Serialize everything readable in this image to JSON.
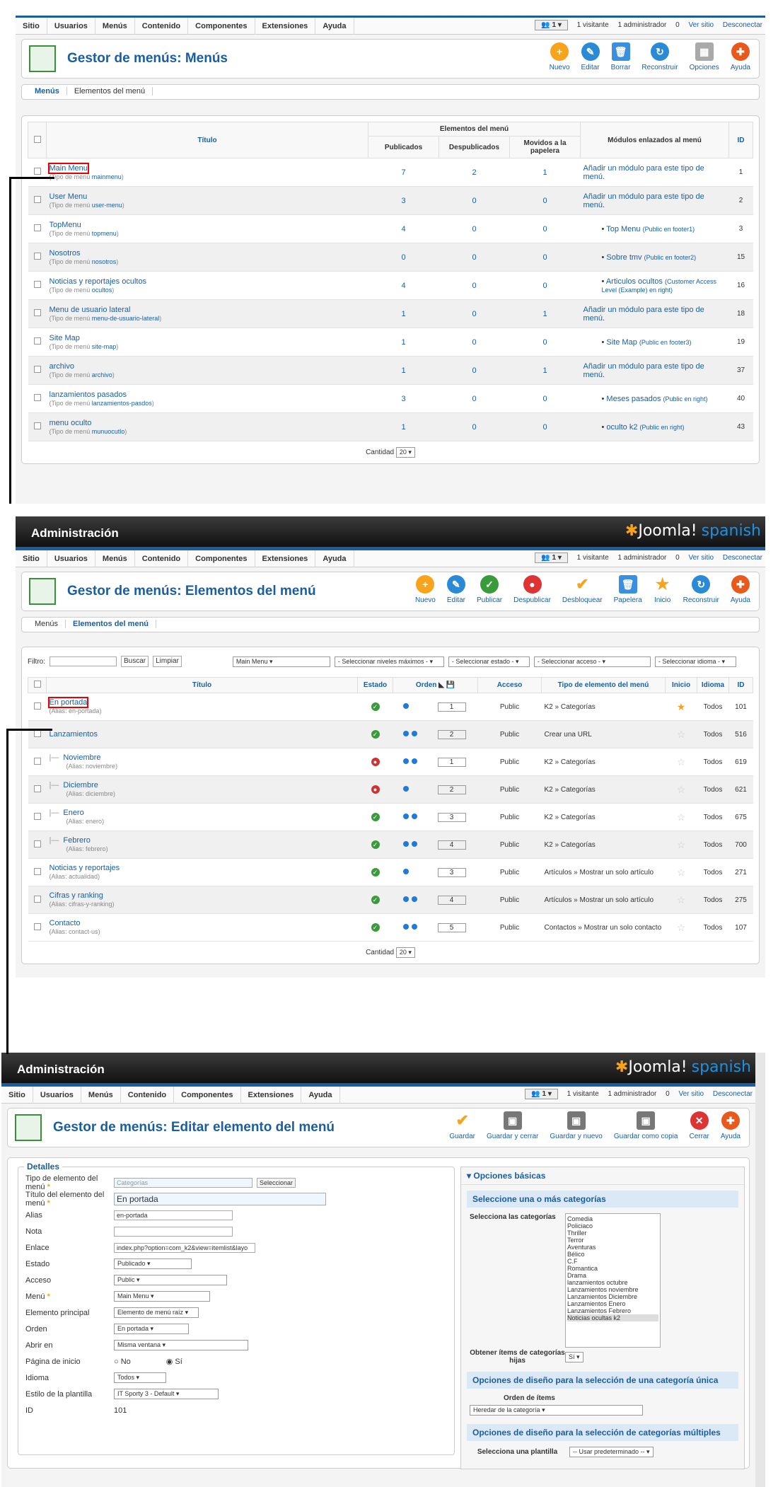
{
  "menubar": [
    "Sitio",
    "Usuarios",
    "Menús",
    "Contenido",
    "Componentes",
    "Extensiones",
    "Ayuda"
  ],
  "status": {
    "users": "1",
    "visitors": "1 visitante",
    "admins": "1 administrador",
    "msgs": "0",
    "view_site": "Ver sitio",
    "logout": "Desconectar"
  },
  "admin_title": "Administración",
  "logo_text": "Joomla!",
  "logo_sub": "spanish",
  "s1": {
    "title": "Gestor de menús: Menús",
    "toolbar": [
      "Nuevo",
      "Editar",
      "Borrar",
      "Reconstruir",
      "Opciones",
      "Ayuda"
    ],
    "tabs": [
      "Menús",
      "Elementos del menú"
    ],
    "group_header": "Elementos del menú",
    "cols": [
      "Título",
      "Publicados",
      "Despublicados",
      "Movidos a la papelera",
      "Módulos enlazados al menú",
      "ID"
    ],
    "type_prefix": "(Tipo de menú",
    "rows": [
      {
        "t": "Main Menu",
        "ty": "mainmenu",
        "p": "7",
        "d": "2",
        "x": "1",
        "mod": "Añadir un módulo para este tipo de menú.",
        "pos": "",
        "id": "1"
      },
      {
        "t": "User Menu",
        "ty": "user-menu",
        "p": "3",
        "d": "0",
        "x": "0",
        "mod": "Añadir un módulo para este tipo de menú.",
        "pos": "",
        "id": "2"
      },
      {
        "t": "TopMenu",
        "ty": "topmenu",
        "p": "4",
        "d": "0",
        "x": "0",
        "mod": "Top Menu",
        "pos": "(Public en footer1)",
        "id": "3"
      },
      {
        "t": "Nosotros",
        "ty": "nosotros",
        "p": "0",
        "d": "0",
        "x": "0",
        "mod": "Sobre tmv",
        "pos": "(Public en footer2)",
        "id": "15"
      },
      {
        "t": "Noticias y reportajes ocultos",
        "ty": "ocultos",
        "p": "4",
        "d": "0",
        "x": "0",
        "mod": "Articulos ocultos",
        "pos": "(Customer Access Level (Example) en right)",
        "id": "16"
      },
      {
        "t": "Menu de usuario lateral",
        "ty": "menu-de-usuario-lateral",
        "p": "1",
        "d": "0",
        "x": "1",
        "mod": "Añadir un módulo para este tipo de menú.",
        "pos": "",
        "id": "18"
      },
      {
        "t": "Site Map",
        "ty": "site-map",
        "p": "1",
        "d": "0",
        "x": "0",
        "mod": "Site Map",
        "pos": "(Public en footer3)",
        "id": "19"
      },
      {
        "t": "archivo",
        "ty": "archivo",
        "p": "1",
        "d": "0",
        "x": "1",
        "mod": "Añadir un módulo para este tipo de menú.",
        "pos": "",
        "id": "37"
      },
      {
        "t": "lanzamientos pasados",
        "ty": "lanzamientos-pasdos",
        "p": "3",
        "d": "0",
        "x": "0",
        "mod": "Meses pasados",
        "pos": "(Public en right)",
        "id": "40"
      },
      {
        "t": "menu oculto",
        "ty": "munuocutlo",
        "p": "1",
        "d": "0",
        "x": "0",
        "mod": "oculto k2",
        "pos": "(Public en right)",
        "id": "43"
      }
    ],
    "cantidad": "Cantidad",
    "cantidad_val": "20"
  },
  "s2": {
    "title": "Gestor de menús: Elementos del menú",
    "toolbar": [
      "Nuevo",
      "Editar",
      "Publicar",
      "Despublicar",
      "Desbloquear",
      "Papelera",
      "Inicio",
      "Reconstruir",
      "Ayuda"
    ],
    "tabs": [
      "Menús",
      "Elementos del menú"
    ],
    "filter_label": "Filtro:",
    "search": "Buscar",
    "clear": "Limpiar",
    "selects": [
      "Main Menu",
      "- Seleccionar niveles máximos -",
      "- Seleccionar estado -",
      "- Seleccionar acceso -",
      "- Seleccionar idioma -"
    ],
    "cols": [
      "Título",
      "Estado",
      "Orden",
      "Acceso",
      "Tipo de elemento del menú",
      "Inicio",
      "Idioma",
      "ID"
    ],
    "alias_prefix": "(Alias:",
    "rows": [
      {
        "t": "En portada",
        "a": "en-portada",
        "pre": "",
        "st": "ok",
        "o": "1",
        "acc": "Public",
        "type": "K2 » Categorías",
        "home": true,
        "lang": "Todos",
        "id": "101"
      },
      {
        "t": "Lanzamientos",
        "a": "",
        "pre": "",
        "st": "ok",
        "o": "2",
        "acc": "Public",
        "type": "Crear una URL",
        "home": false,
        "lang": "Todos",
        "id": "516"
      },
      {
        "t": "Noviembre",
        "a": "noviembre",
        "pre": "|—",
        "st": "no",
        "o": "1",
        "acc": "Public",
        "type": "K2 » Categorías",
        "home": false,
        "lang": "Todos",
        "id": "619"
      },
      {
        "t": "Diciembre",
        "a": "diciembre",
        "pre": "|—",
        "st": "no",
        "o": "2",
        "acc": "Public",
        "type": "K2 » Categorías",
        "home": false,
        "lang": "Todos",
        "id": "621"
      },
      {
        "t": "Enero",
        "a": "enero",
        "pre": "|—",
        "st": "ok",
        "o": "3",
        "acc": "Public",
        "type": "K2 » Categorías",
        "home": false,
        "lang": "Todos",
        "id": "675"
      },
      {
        "t": "Febrero",
        "a": "febrero",
        "pre": "|—",
        "st": "ok",
        "o": "4",
        "acc": "Public",
        "type": "K2 » Categorías",
        "home": false,
        "lang": "Todos",
        "id": "700"
      },
      {
        "t": "Noticias y reportajes",
        "a": "actualidad",
        "pre": "",
        "st": "ok",
        "o": "3",
        "acc": "Public",
        "type": "Artículos » Mostrar un solo artículo",
        "home": false,
        "lang": "Todos",
        "id": "271"
      },
      {
        "t": "Cifras y ranking",
        "a": "cifras-y-ranking",
        "pre": "",
        "st": "ok",
        "o": "4",
        "acc": "Public",
        "type": "Artículos » Mostrar un solo artículo",
        "home": false,
        "lang": "Todos",
        "id": "275"
      },
      {
        "t": "Contacto",
        "a": "contact-us",
        "pre": "",
        "st": "ok",
        "o": "5",
        "acc": "Public",
        "type": "Contactos » Mostrar un solo contacto",
        "home": false,
        "lang": "Todos",
        "id": "107"
      }
    ],
    "cantidad": "Cantidad",
    "cantidad_val": "20"
  },
  "s3": {
    "title": "Gestor de menús: Editar elemento del menú",
    "toolbar": [
      "Guardar",
      "Guardar y cerrar",
      "Guardar y nuevo",
      "Guardar como copia",
      "Cerrar",
      "Ayuda"
    ],
    "legend": "Detalles",
    "fields": [
      {
        "l": "Tipo de elemento del menú",
        "req": true,
        "v": "Categorías",
        "btn": "Seleccionar"
      },
      {
        "l": "Título del elemento del menú",
        "req": true,
        "v": "En portada"
      },
      {
        "l": "Alias",
        "v": "en-portada"
      },
      {
        "l": "Nota",
        "v": ""
      },
      {
        "l": "Enlace",
        "v": "index.php?option=com_k2&view=itemlist&layo"
      },
      {
        "l": "Estado",
        "v": "Publicado"
      },
      {
        "l": "Acceso",
        "v": "Public"
      },
      {
        "l": "Menú",
        "req": true,
        "v": "Main Menu"
      },
      {
        "l": "Elemento principal",
        "v": "Elemento de menú raíz"
      },
      {
        "l": "Orden",
        "v": "En portada"
      },
      {
        "l": "Abrir en",
        "v": "Misma ventana"
      },
      {
        "l": "Página de inicio",
        "v": ""
      },
      {
        "l": "Idioma",
        "v": "Todos"
      },
      {
        "l": "Estilo de la plantilla",
        "v": "IT Sporty 3 - Default"
      },
      {
        "l": "ID",
        "v": "101"
      }
    ],
    "radio_no": "No",
    "radio_si": "Sí",
    "opts_title": "Opciones básicas",
    "cat_head": "Seleccione una o más categorías",
    "cat_label": "Selecciona las categorías",
    "cats": [
      "Comedia",
      "Policiaco",
      "Thriller",
      "Terror",
      "Aventuras",
      "Bélico",
      "C.F",
      "Romantica",
      "Drama",
      "lanzamientos octubre",
      "Lanzamientos noviembre",
      "Lanzamientos Diciembre",
      "Lanzamientos Enero",
      "Lanzamientos Febrero",
      "Noticias ocultas k2"
    ],
    "child_label": "Obtener ítems de categorías hijas",
    "child_val": "Sí",
    "single_head": "Opciones de diseño para la selección de una categoría única",
    "order_label": "Orden de ítems",
    "order_val": "Heredar de la categoría",
    "multi_head": "Opciones de diseño para la selección de categorías múltiples",
    "tpl_label": "Selecciona una plantilla",
    "tpl_val": "-- Usar predeterminado --"
  }
}
